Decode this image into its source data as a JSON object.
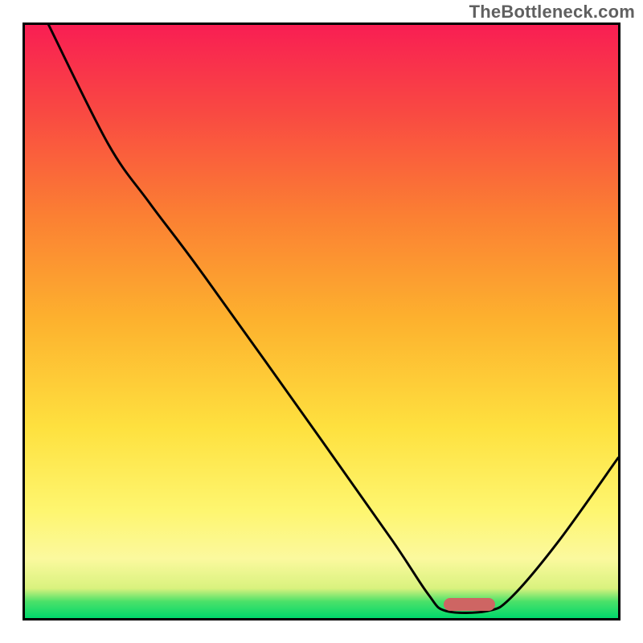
{
  "watermark": "TheBottleneck.com",
  "chart_data": {
    "type": "line",
    "title": "",
    "xlabel": "",
    "ylabel": "",
    "x_range": [
      0,
      100
    ],
    "y_range": [
      0,
      100
    ],
    "gradient_stops": [
      {
        "pos": 0.0,
        "color": "#00d86b"
      },
      {
        "pos": 0.028,
        "color": "#4be169"
      },
      {
        "pos": 0.05,
        "color": "#d9f27e"
      },
      {
        "pos": 0.1,
        "color": "#fbf99e"
      },
      {
        "pos": 0.18,
        "color": "#fef670"
      },
      {
        "pos": 0.32,
        "color": "#fee13f"
      },
      {
        "pos": 0.5,
        "color": "#fdb22e"
      },
      {
        "pos": 0.68,
        "color": "#fb7f33"
      },
      {
        "pos": 0.85,
        "color": "#f94a42"
      },
      {
        "pos": 1.0,
        "color": "#f91e53"
      }
    ],
    "series": [
      {
        "name": "bottleneck-curve",
        "points": [
          {
            "x": 4.0,
            "y": 100.0
          },
          {
            "x": 14.0,
            "y": 80.0
          },
          {
            "x": 21.0,
            "y": 70.0
          },
          {
            "x": 30.0,
            "y": 58.0
          },
          {
            "x": 50.0,
            "y": 30.0
          },
          {
            "x": 62.0,
            "y": 13.0
          },
          {
            "x": 68.0,
            "y": 4.0
          },
          {
            "x": 71.0,
            "y": 1.2
          },
          {
            "x": 78.0,
            "y": 1.2
          },
          {
            "x": 82.0,
            "y": 3.5
          },
          {
            "x": 90.0,
            "y": 13.0
          },
          {
            "x": 100.0,
            "y": 27.0
          }
        ]
      }
    ],
    "trough_marker": {
      "x": 74.5,
      "y": 2.6,
      "color": "#ce6563"
    }
  }
}
